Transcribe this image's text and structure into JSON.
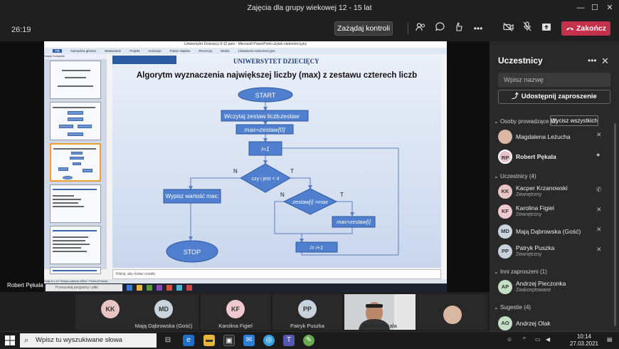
{
  "window": {
    "title": "Zajęcia dla grupy wiekowej 12 - 15 lat",
    "minimize": "—",
    "maximize": "☐",
    "close": "✕"
  },
  "toolbar": {
    "timer": "26:19",
    "control_label": "Zażądaj kontroli",
    "leave_label": "Zakończ",
    "leave_color": "#c4314b"
  },
  "stage": {
    "presenter_name": "Robert Pękala",
    "ppt": {
      "title": "Uniwersytet Dziecięcy 9-12.pptx - Microsoft PowerPoint użytek niekomercyjny",
      "ribbon": [
        "Plik",
        "Narzędzia główne",
        "Wstawianie",
        "Projekt",
        "Animacje",
        "Pokaz slajdów",
        "Recenzja",
        "Widok",
        "Ustawienia niekomercyjne"
      ],
      "panel_tabs": "Slajdy   Konspekt",
      "notes_placeholder": "Kliknij, aby dodać notatki",
      "status": "Slajd 6 z 10   \"Motyw pakietu Office\"   Polski (Polska)"
    },
    "slide": {
      "university": "UNIWERSYTET DZIECIĘCY",
      "title": "Algorytm wyznaczenia największej liczby (max) z zestawu czterech liczb",
      "start": "START",
      "read": "Wczytaj zestaw liczb",
      "read_var": "zestaw",
      "assign_max": "max=zestaw[0]",
      "assign_i": "i=1",
      "cond1": "czy i jest < 4",
      "cond2": "zestaw[i] >max",
      "assign_max_i": "max=zestaw[i]",
      "increment": "i= i+1",
      "output": "Wypisz wartość max:",
      "stop": "STOP",
      "no": "N",
      "yes": "T"
    },
    "win7_search": "Przeszukaj programy i pliki",
    "win7_clock": "10:14\n27.03.2021"
  },
  "gallery": [
    {
      "initials": "KK",
      "name": "",
      "color": "#e8c4c4"
    },
    {
      "initials": "MD",
      "name": "Mają Dąbrowska (Gość)",
      "color": "#c9d4dd"
    },
    {
      "initials": "KF",
      "name": "Karolina Figiel",
      "color": "#f0c8d0"
    },
    {
      "initials": "PP",
      "name": "Patryk Puszka",
      "color": "#c8d2dd"
    },
    {
      "initials": "",
      "name": "Robert Pękala",
      "color": "#6f6f6f"
    }
  ],
  "panel": {
    "title": "Uczestnicy",
    "search_placeholder": "Wpisz nazwę",
    "share_label": "Udostępnij zaproszenie",
    "presenters_label": "Osoby prowadzące (2)",
    "mute_all": "Wycisz wszystkich",
    "presenters": [
      {
        "initials": "",
        "name": "Magdalena Leżucha",
        "sub": "",
        "color": "#d9b7a0"
      },
      {
        "initials": "RP",
        "name": "Robert Pękala",
        "sub": "",
        "color": "#e8c4c8"
      }
    ],
    "attendees_label": "Uczestnicy (4)",
    "attendees": [
      {
        "initials": "KK",
        "name": "Kacper Krzanowski",
        "sub": "Zewnętrzny",
        "color": "#e8c4c4"
      },
      {
        "initials": "KF",
        "name": "Karolina Figiel",
        "sub": "Zewnętrzny",
        "color": "#f0c8d0"
      },
      {
        "initials": "MD",
        "name": "Mają Dąbrowska (Gość)",
        "sub": "",
        "color": "#c9d4dd"
      },
      {
        "initials": "PP",
        "name": "Patryk Puszka",
        "sub": "Zewnętrzny",
        "color": "#c8d2dd"
      }
    ],
    "invited_label": "Inni zaproszeni (1)",
    "invited": [
      {
        "initials": "AP",
        "name": "Andrzej Pieczonka",
        "sub": "Zaakceptowane",
        "color": "#c4e0c4"
      }
    ],
    "suggestions_label": "Sugestie (4)",
    "suggestions": [
      {
        "initials": "AO",
        "name": "Andrzej Olak",
        "sub": "",
        "color": "#c4e0c4"
      }
    ]
  },
  "taskbar": {
    "search": "Wpisz tu wyszukiwane słowa",
    "time": "10:14",
    "date": "27.03.2021"
  }
}
